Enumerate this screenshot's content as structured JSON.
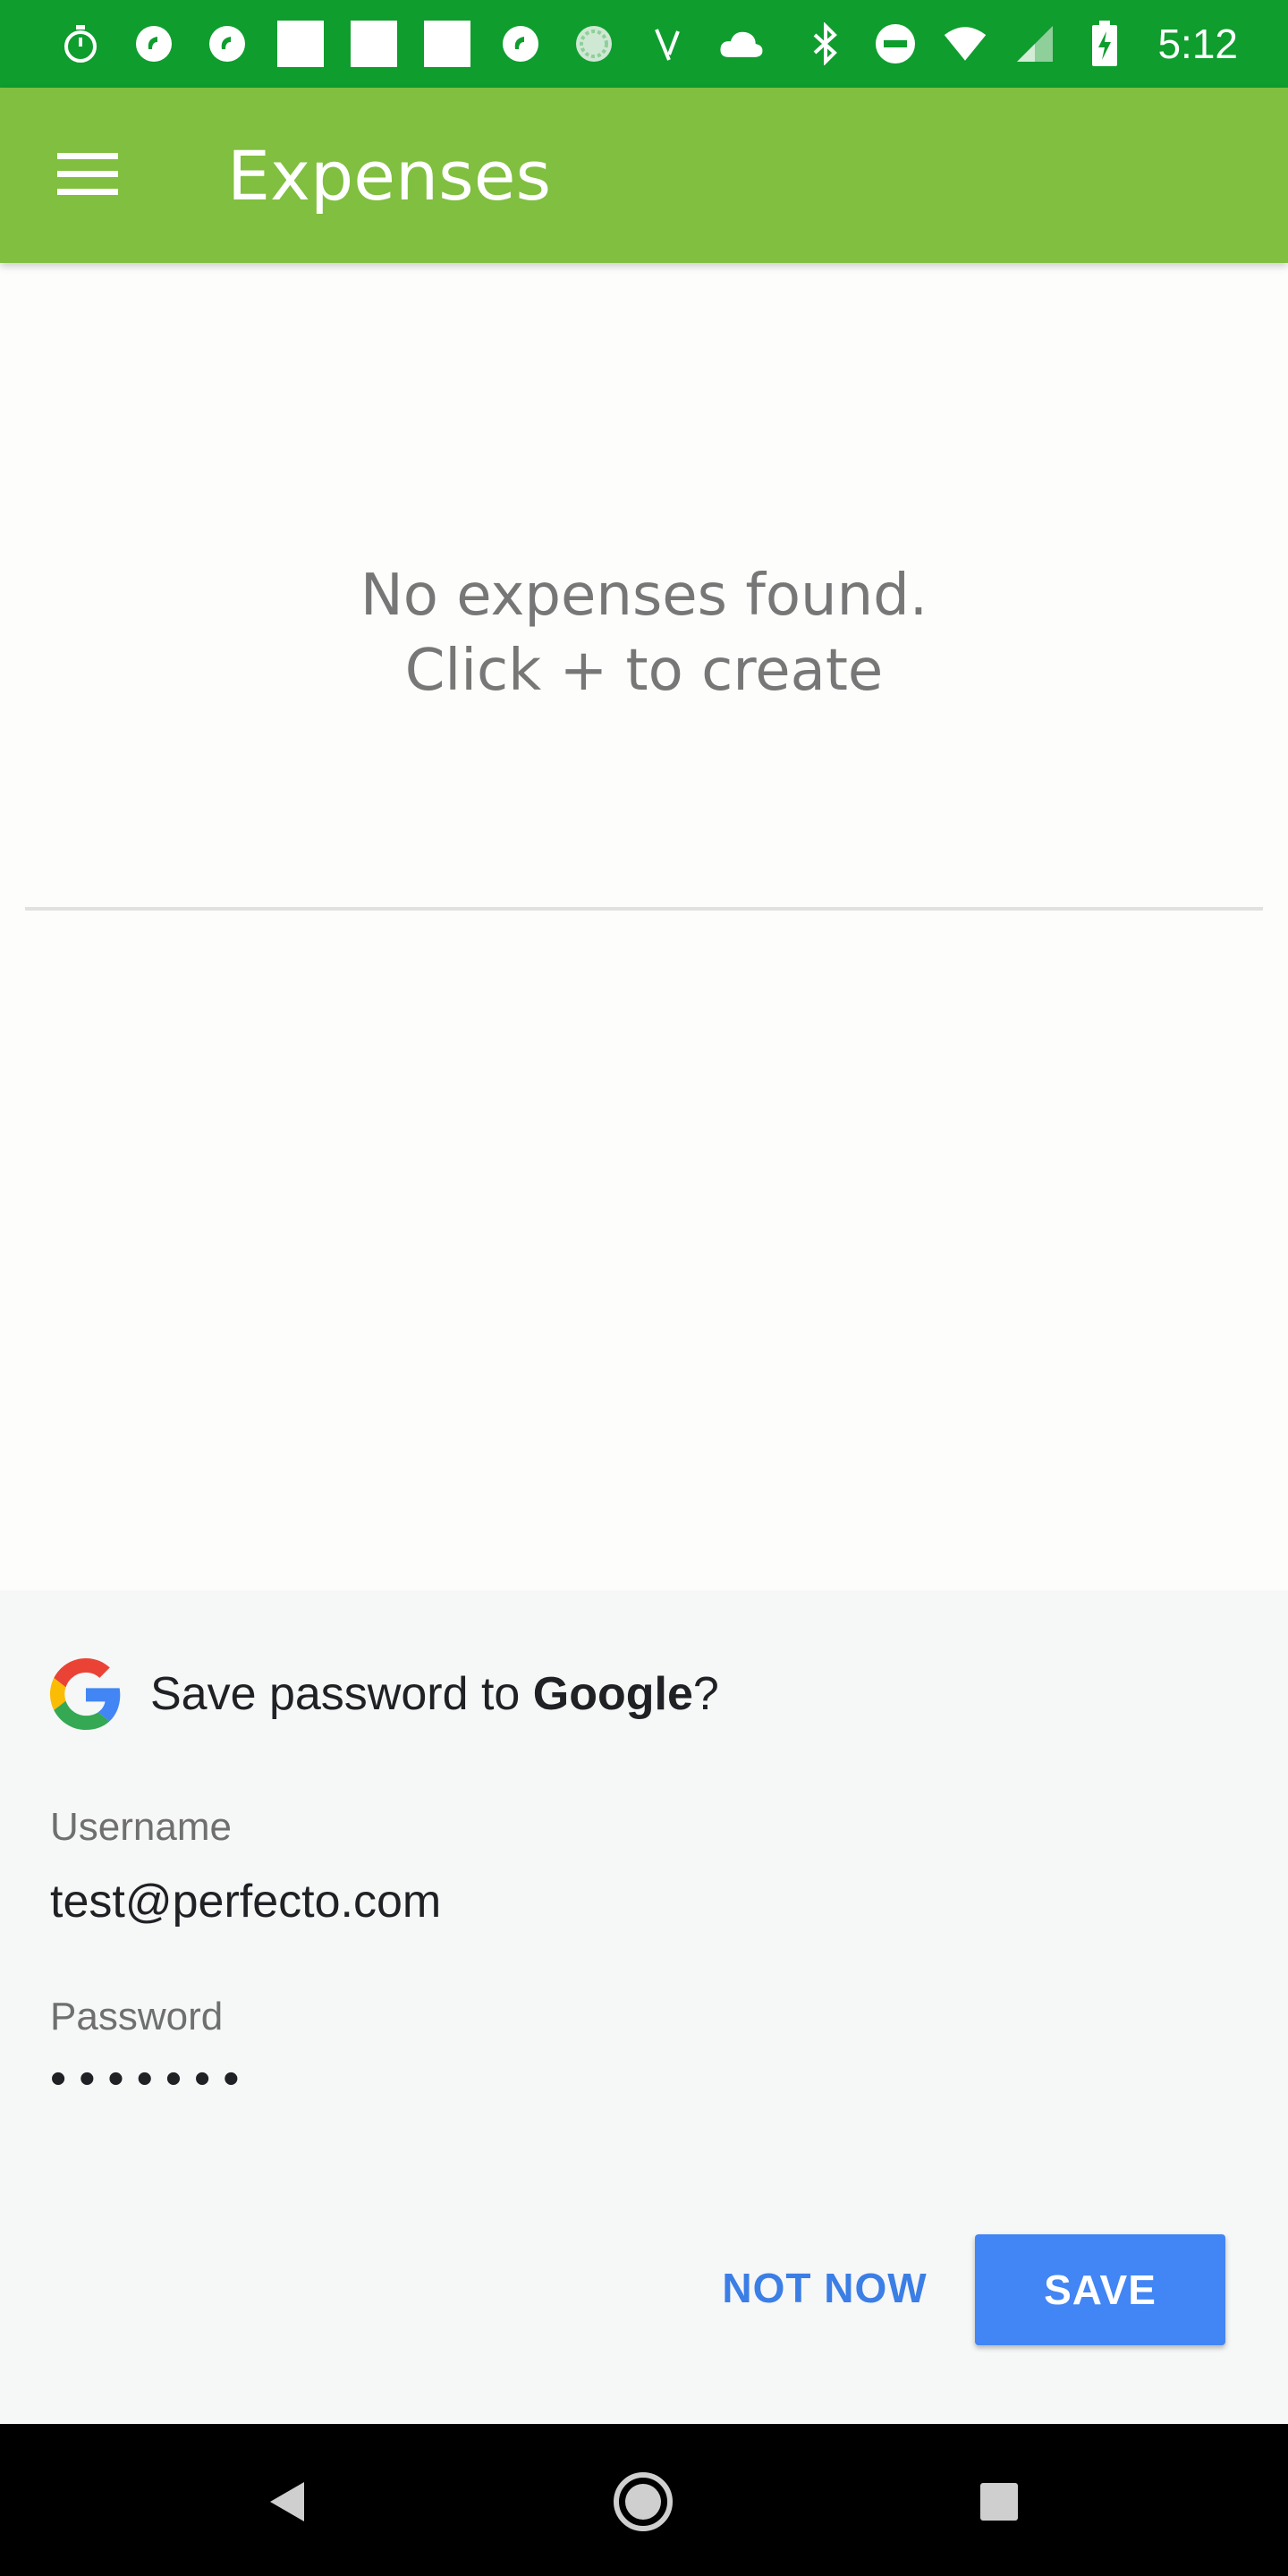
{
  "status_bar": {
    "time": "5:12",
    "left_icons": [
      "stopwatch-icon",
      "app-notification-icon",
      "app-notification-icon",
      "square-notification-icon",
      "square-notification-icon",
      "square-notification-icon",
      "app-notification-icon",
      "sync-icon",
      "tools-icon",
      "cloud-icon"
    ],
    "right_icons": [
      "bluetooth-icon",
      "do-not-disturb-icon",
      "wifi-icon",
      "signal-icon",
      "battery-icon"
    ]
  },
  "app_bar": {
    "title": "Expenses",
    "menu_icon": "menu-icon",
    "color": "#80bf3f"
  },
  "main": {
    "empty_line1": "No expenses found.",
    "empty_line2": "Click + to create"
  },
  "save_password": {
    "title_prefix": "Save password to ",
    "title_brand": "Google",
    "title_suffix": "?",
    "username_label": "Username",
    "username_value": "test@perfecto.com",
    "password_label": "Password",
    "password_value": "•••••••",
    "not_now_label": "NOT NOW",
    "save_label": "SAVE",
    "accent_color": "#4285f4"
  },
  "nav_bar": {
    "back_icon": "back-icon",
    "home_icon": "home-icon",
    "recents_icon": "recents-icon"
  },
  "colors": {
    "status_bar": "#0f9d2e",
    "app_bar": "#80bf3f",
    "sheet_background": "#f6f7f7",
    "nav_bar": "#000000"
  }
}
